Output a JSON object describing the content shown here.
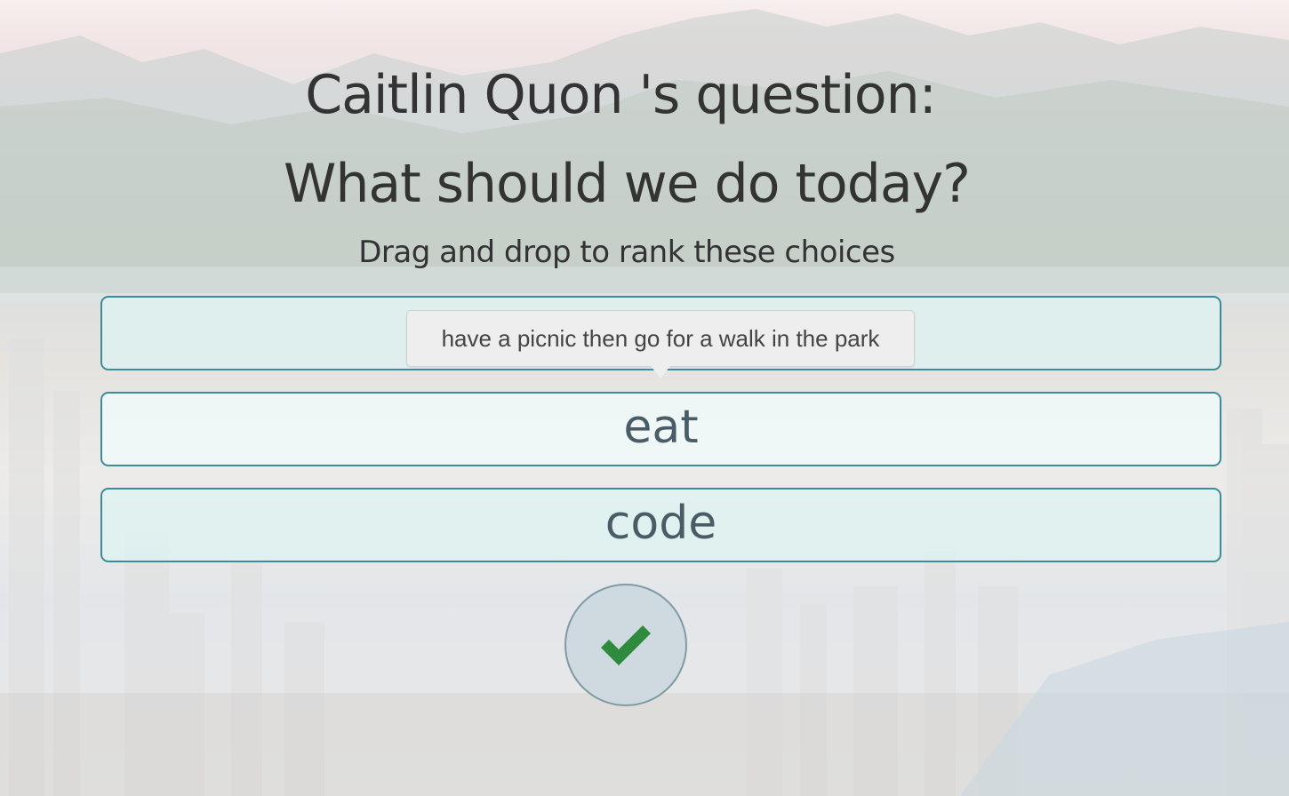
{
  "page": {
    "asker_title": "Caitlin Quon 's question:",
    "question": "What should we do today?",
    "instructions": "Drag and drop to rank these choices"
  },
  "choices": [
    {
      "label": "",
      "tooltip": "have a picnic then go for a walk in the park"
    },
    {
      "label": "eat"
    },
    {
      "label": "code"
    }
  ],
  "submit": {
    "icon": "checkmark-icon"
  },
  "colors": {
    "choice_border": "#3b8c98",
    "choice_fill": "#def4f2",
    "checkmark": "#2e8b3e",
    "text": "#333333"
  }
}
